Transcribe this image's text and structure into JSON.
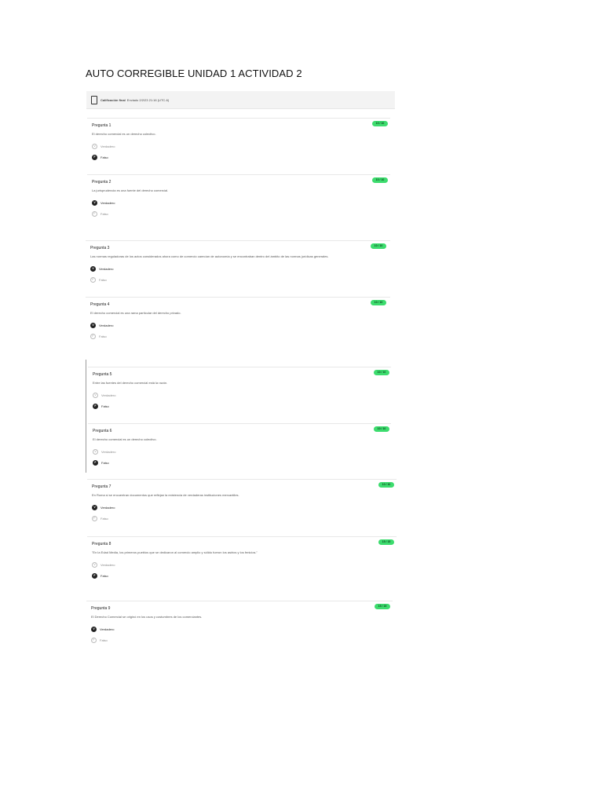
{
  "document": {
    "title": "AUTO CORREGIBLE UNIDAD 1 ACTIVIDAD 2"
  },
  "grade": {
    "label": "Calificación final",
    "detail": "Enviado 2/2/23 21:16 (UTC-6)"
  },
  "questions": [
    {
      "title": "Pregunta 1",
      "score": "10 / 10",
      "text": "El derecho comercial es un derecho colectivo.",
      "options": [
        {
          "letter": "V",
          "label": "Verdadero"
        },
        {
          "letter": "F",
          "label": "Falso"
        }
      ],
      "selected": 1
    },
    {
      "title": "Pregunta 2",
      "score": "10 / 10",
      "text": "La jurisprudencia es una fuente del derecho comercial.",
      "options": [
        {
          "letter": "V",
          "label": "Verdadero"
        },
        {
          "letter": "F",
          "label": "Falso"
        }
      ],
      "selected": 0
    },
    {
      "title": "Pregunta 3",
      "score": "10 / 10",
      "text": "Las normas reguladoras de los actos considerados ahora como de comercio carecían de autonomía y se encontraban dentro del ámbito de las normas jurídicas generales.",
      "options": [
        {
          "letter": "V",
          "label": "Verdadero"
        },
        {
          "letter": "F",
          "label": "Falso"
        }
      ],
      "selected": 0
    },
    {
      "title": "Pregunta 4",
      "score": "10 / 10",
      "text": "El derecho comercial es una rama particular del derecho privado.",
      "options": [
        {
          "letter": "V",
          "label": "Verdadero"
        },
        {
          "letter": "F",
          "label": "Falso"
        }
      ],
      "selected": 0
    },
    {
      "title": "Pregunta 5",
      "score": "10 / 10",
      "text": "Entre las fuentes del derecho comercial está la razón.",
      "options": [
        {
          "letter": "V",
          "label": "Verdadero"
        },
        {
          "letter": "F",
          "label": "Falso"
        }
      ],
      "selected": 1
    },
    {
      "title": "Pregunta 6",
      "score": "10 / 10",
      "text": "El derecho comercial es un derecho colectivo.",
      "options": [
        {
          "letter": "V",
          "label": "Verdadero"
        },
        {
          "letter": "F",
          "label": "Falso"
        }
      ],
      "selected": 1
    },
    {
      "title": "Pregunta 7",
      "score": "10 / 10",
      "text": "En Roma si se encuentran documentos que reflejan la existencia de verdaderas instituciones mercantiles.",
      "options": [
        {
          "letter": "V",
          "label": "Verdadero"
        },
        {
          "letter": "F",
          "label": "Falso"
        }
      ],
      "selected": 0
    },
    {
      "title": "Pregunta 8",
      "score": "15 / 15",
      "text": "\"En la Edad Media, los primeros pueblos que se dedicaron al comercio amplio y sólido fueron los asirios y los fenicios.\"",
      "options": [
        {
          "letter": "V",
          "label": "Verdadero"
        },
        {
          "letter": "F",
          "label": "Falso"
        }
      ],
      "selected": 1
    },
    {
      "title": "Pregunta 9",
      "score": "15 / 15",
      "text": "El Derecho Comercial se originó en los usos y costumbres de los comerciantes.",
      "options": [
        {
          "letter": "V",
          "label": "Verdadero"
        },
        {
          "letter": "F",
          "label": "Falso"
        }
      ],
      "selected": 0
    }
  ],
  "colors": {
    "badge": "#3ddc6e",
    "selected": "#222222",
    "unselected": "#bbbbbb"
  }
}
